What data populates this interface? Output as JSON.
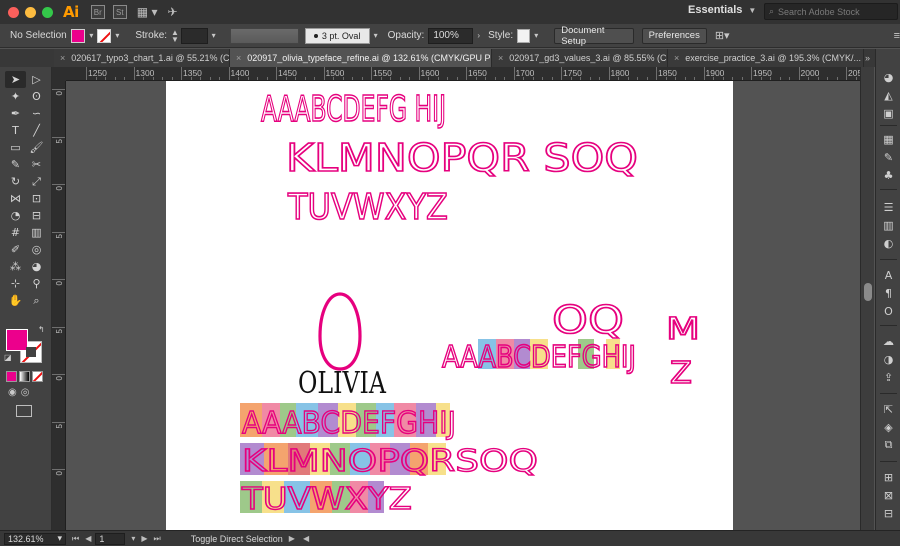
{
  "app": {
    "logo": "Ai",
    "bridge_label": "Br",
    "stock_label": "St",
    "workspace": "Essentials",
    "stock_search_placeholder": "Search Adobe Stock"
  },
  "control_bar": {
    "selection": "No Selection",
    "stroke_label": "Stroke:",
    "brush": "3 pt. Oval",
    "opacity_label": "Opacity:",
    "opacity_value": "100%",
    "style_label": "Style:",
    "document_setup": "Document Setup",
    "preferences": "Preferences",
    "fill_color": "#ec008c"
  },
  "tabs": [
    {
      "label": "020617_typo3_chart_1.ai @ 55.21% (CMY..."
    },
    {
      "label": "020917_olivia_typeface_refine.ai @ 132.61% (CMYK/GPU Preview)"
    },
    {
      "label": "020917_gd3_values_3.ai @ 85.55% (CMYK..."
    },
    {
      "label": "exercise_practice_3.ai @ 195.3% (CMYK/..."
    }
  ],
  "ruler": {
    "h_labels": [
      "1250",
      "1300",
      "1350",
      "1400",
      "1450",
      "1500",
      "1550",
      "1600",
      "1650",
      "1700",
      "1750",
      "1800",
      "1850",
      "1900",
      "1950",
      "2000",
      "2050"
    ],
    "v_labels": [
      "0",
      "5",
      "0",
      "5",
      "0",
      "5",
      "0",
      "5",
      "0"
    ]
  },
  "artwork": {
    "alphabet_line_1": "AAABCDEFG HIJ",
    "alphabet_line_2": "KLMNOPQR SOQ",
    "alphabet_line_3": "TUVWXYZ",
    "name_label": "OLIVIA",
    "strip_line_1": "AAABCDEFGHIJ",
    "strip_line_2": "KLMNOPQRSOQ",
    "strip_line_3": "TUVWXYZ",
    "right_group_top": "OQ",
    "right_group_line": "AAABCDEFGHIJ",
    "right_group_side_top": "M",
    "right_group_side_bottom": "Z",
    "ink_color": "#e6007e"
  },
  "status": {
    "zoom": "132.61%",
    "artboard": "1",
    "message": "Toggle Direct Selection"
  }
}
